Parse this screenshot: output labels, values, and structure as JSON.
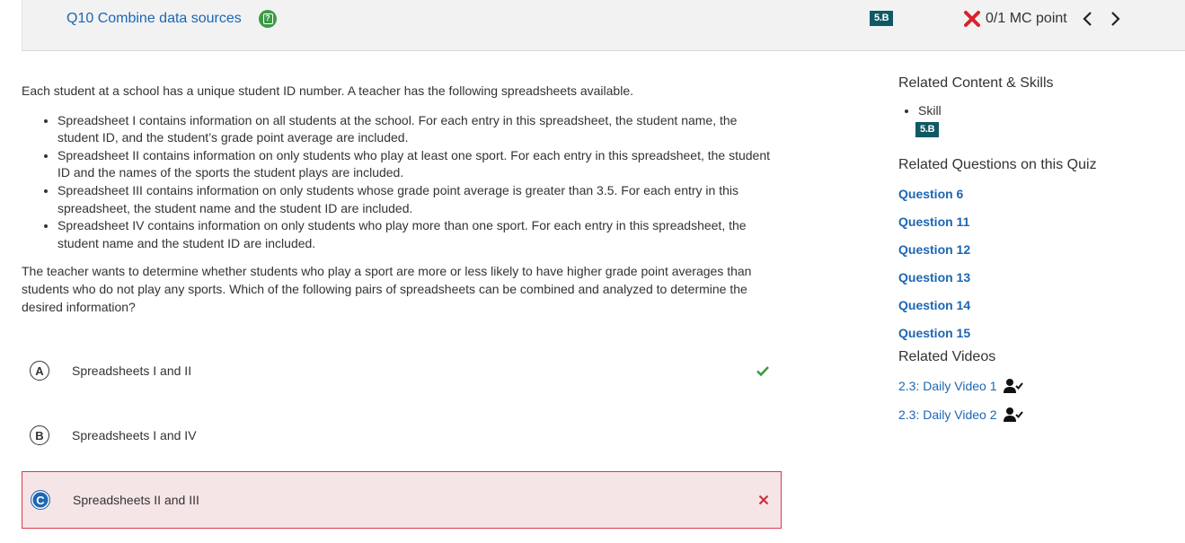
{
  "header": {
    "question_title": "Q10 Combine data sources",
    "help_icon": "help-icon",
    "skill_tag": "5.B",
    "score_text": "0/1 MC point"
  },
  "question": {
    "intro": "Each student at a school has a unique student ID number. A teacher has the following spreadsheets available.",
    "bullets": [
      "Spreadsheet I contains information on all students at the school. For each entry in this spreadsheet, the student name, the student ID, and the student’s grade point average are included.",
      "Spreadsheet II contains information on only students who play at least one sport. For each entry in this spreadsheet, the student ID and the names of the sports the student plays are included.",
      "Spreadsheet III contains information on only students whose grade point average is greater than 3.5. For each entry in this spreadsheet, the student name and the student ID are included.",
      "Spreadsheet IV contains information on only students who play more than one sport. For each entry in this spreadsheet, the student name and the student ID are included."
    ],
    "prompt": "The teacher wants to determine whether students who play a sport are more or less likely to have higher grade point averages than students who do not play any sports. Which of the following pairs of spreadsheets can be combined and analyzed to determine the desired information?"
  },
  "choices": [
    {
      "letter": "A",
      "text": "Spreadsheets I and II",
      "status": "correct"
    },
    {
      "letter": "B",
      "text": "Spreadsheets I and IV",
      "status": "none"
    },
    {
      "letter": "C",
      "text": "Spreadsheets II and III",
      "status": "selected-wrong"
    }
  ],
  "sidebar": {
    "related_content_title": "Related Content & Skills",
    "skill_label": "Skill",
    "skill_tag": "5.B",
    "related_questions_title": "Related Questions on this Quiz",
    "questions": [
      "Question 6",
      "Question 11",
      "Question 12",
      "Question 13",
      "Question 14",
      "Question 15"
    ],
    "related_videos_title": "Related Videos",
    "videos": [
      "2.3: Daily Video 1",
      "2.3: Daily Video 2"
    ]
  },
  "colors": {
    "link": "#1d66b3",
    "correct": "#3c9b45",
    "wrong": "#d83a4d",
    "skill_tag_bg": "#0e5963"
  }
}
